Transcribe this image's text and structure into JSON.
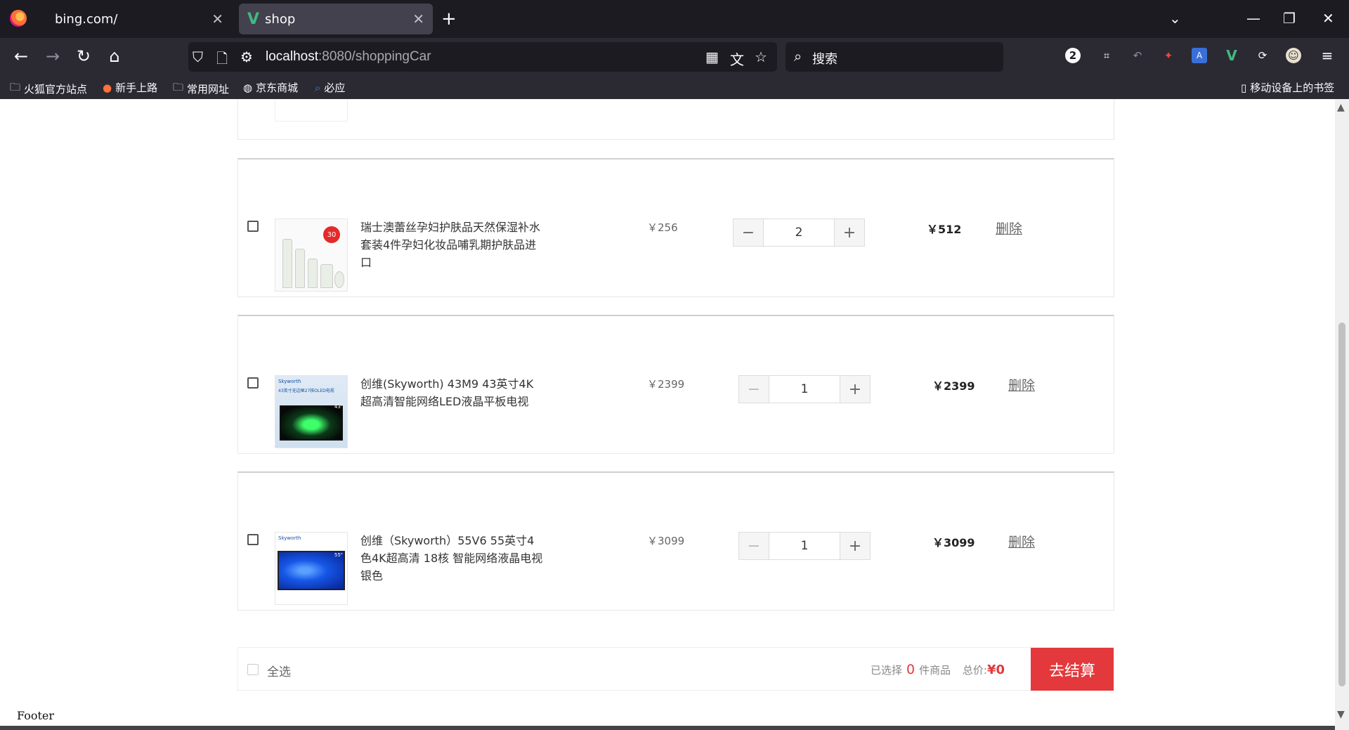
{
  "browser": {
    "tabs": [
      {
        "title": "bing.com/",
        "active": false
      },
      {
        "title": "shop",
        "active": true
      }
    ],
    "url": {
      "host": "localhost",
      "rest": ":8080/shoppingCar"
    },
    "search_placeholder": "搜索",
    "notification_count": "2",
    "bookmarks": [
      "火狐官方站点",
      "新手上路",
      "常用网址",
      "京东商城",
      "必应"
    ],
    "mobile_bookmarks": "移动设备上的书签"
  },
  "cart": {
    "items": [
      {
        "name": "瑞士澳蕾丝孕妇护肤品天然保湿补水套装4件孕妇化妆品哺乳期护肤品进口",
        "price": "￥256",
        "quantity": "2",
        "subtotal": "￥512",
        "delete_label": "删除",
        "badge": "30",
        "minus_disabled": false
      },
      {
        "name": "创维(Skyworth) 43M9 43英寸4K超高清智能网络LED液晶平板电视",
        "price": "￥2399",
        "quantity": "1",
        "subtotal": "￥2399",
        "delete_label": "删除",
        "img_brand": "Skyworth",
        "img_caption": "43英寸无边框27核OLED电视",
        "img_size": "43\"",
        "minus_disabled": true
      },
      {
        "name": "创维（Skyworth）55V6 55英寸4色4K超高清 18核 智能网络液晶电视 银色",
        "price": "￥3099",
        "quantity": "1",
        "subtotal": "￥3099",
        "delete_label": "删除",
        "img_brand": "Skyworth",
        "img_size": "55\"",
        "minus_disabled": true
      }
    ],
    "select_all_label": "全选",
    "selected_prefix": "已选择",
    "selected_count": "0",
    "selected_suffix": "件商品",
    "total_label": "总价:",
    "total_value": "¥0",
    "checkout_label": "去结算"
  },
  "footer_text": "Footer"
}
